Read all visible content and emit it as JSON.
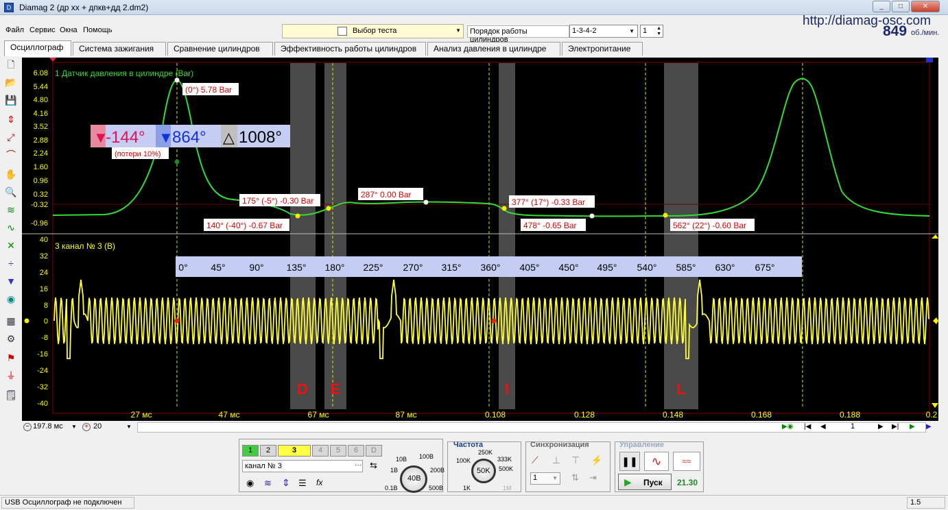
{
  "window": {
    "title": "Diamag 2 (др хх + дпкв+дд 2.dm2)",
    "controls": [
      "_",
      "□",
      "✕"
    ]
  },
  "site": {
    "url": "http://diamag-osc.com"
  },
  "rpm": {
    "value": "849",
    "unit": "об./мин."
  },
  "menu": [
    "Файл",
    "Сервис",
    "Окна",
    "Помощь"
  ],
  "test_select": {
    "label": "Выбор теста"
  },
  "firing_order": {
    "label": "Порядок работы цилиндров",
    "value": "1-3-4-2",
    "cylinder": "1"
  },
  "tabs": [
    {
      "label": "Осциллограф",
      "active": true
    },
    {
      "label": "Система зажигания",
      "active": false
    },
    {
      "label": "Сравнение цилиндров",
      "active": false
    },
    {
      "label": "Эффективность работы цилиндров",
      "active": false
    },
    {
      "label": "Анализ давления в цилиндре",
      "active": false
    },
    {
      "label": "Электропитание",
      "active": false
    }
  ],
  "toolbar_icons": [
    "new-file-icon",
    "open-folder-icon",
    "save-disk-icon",
    "auto-scale-icon",
    "cursor-measure-icon",
    "sync-icon",
    "hand-pan-icon",
    "zoom-icon",
    "filter-icon",
    "math-icon",
    "split-icon",
    "center-icon",
    "marker-icon",
    "cylinder-icon",
    "table-icon",
    "auto-settings-icon",
    "flag-icon",
    "zero-icon",
    "notes-icon"
  ],
  "scope": {
    "colors": {
      "pressure": "#33dd33",
      "voltage": "#ffff00",
      "label_bg": "#ffffff",
      "label_fg": "#dd0000",
      "zone": "#4a4a4a"
    },
    "upper": {
      "title": "1 Датчик давления в цилиндре (Bar)",
      "y_ticks": [
        "6.08",
        "5.44",
        "4.80",
        "4.16",
        "3.52",
        "2.88",
        "2.24",
        "1.60",
        "0.96",
        "0.32",
        "-0.32",
        "-0.96"
      ],
      "annotations": [
        "(0°) 5.78 Bar",
        "175° (-5°) -0.30 Bar",
        "140° (-40°) -0.67 Bar",
        "287° 0.00 Bar",
        "377° (17°) -0.33 Bar",
        "478° -0.65 Bar",
        "562° (22°) -0.60 Bar"
      ],
      "cursor_a": "-144°",
      "cursor_b": "864°",
      "delta": "1008°",
      "loss": "(потери 10%)"
    },
    "lower": {
      "title": "3 канал № 3 (В)",
      "y_ticks": [
        "40",
        "32",
        "24",
        "16",
        "8",
        "0",
        "-8",
        "-16",
        "-24",
        "-32",
        "-40"
      ],
      "angle_scale": [
        "0°",
        "45°",
        "90°",
        "135°",
        "180°",
        "225°",
        "270°",
        "315°",
        "360°",
        "405°",
        "450°",
        "495°",
        "540°",
        "585°",
        "630°",
        "675°"
      ],
      "zone_letters": [
        "D",
        "E",
        "I",
        "L"
      ]
    },
    "x_ticks": [
      "27 мс",
      "47 мс",
      "67 мс",
      "87 мс",
      "0.108",
      "0.128",
      "0.148",
      "0.168",
      "0.188",
      "0.2"
    ]
  },
  "bottom_controls": {
    "timebase": "197.8 мс",
    "zoom": "20",
    "page": "1"
  },
  "panel": {
    "channels": [
      "1",
      "2",
      "3",
      "4",
      "5",
      "6",
      "D"
    ],
    "channel_name": "канал № 3",
    "voltage": {
      "value": "40В",
      "labels": [
        "10В",
        "100В",
        "1В",
        "200В",
        "0.1В",
        "500В"
      ]
    },
    "freq": {
      "title": "Частота",
      "value": "50K",
      "labels": [
        "250K",
        "100K",
        "333K",
        "500K",
        "1K",
        "1M"
      ]
    },
    "sync": {
      "title": "Синхронизация",
      "value": "1"
    },
    "control": {
      "title": "Управление",
      "start": "Пуск",
      "value": "21.30"
    }
  },
  "status": {
    "text": "USB Осциллограф не подключен",
    "right": "1.5"
  }
}
